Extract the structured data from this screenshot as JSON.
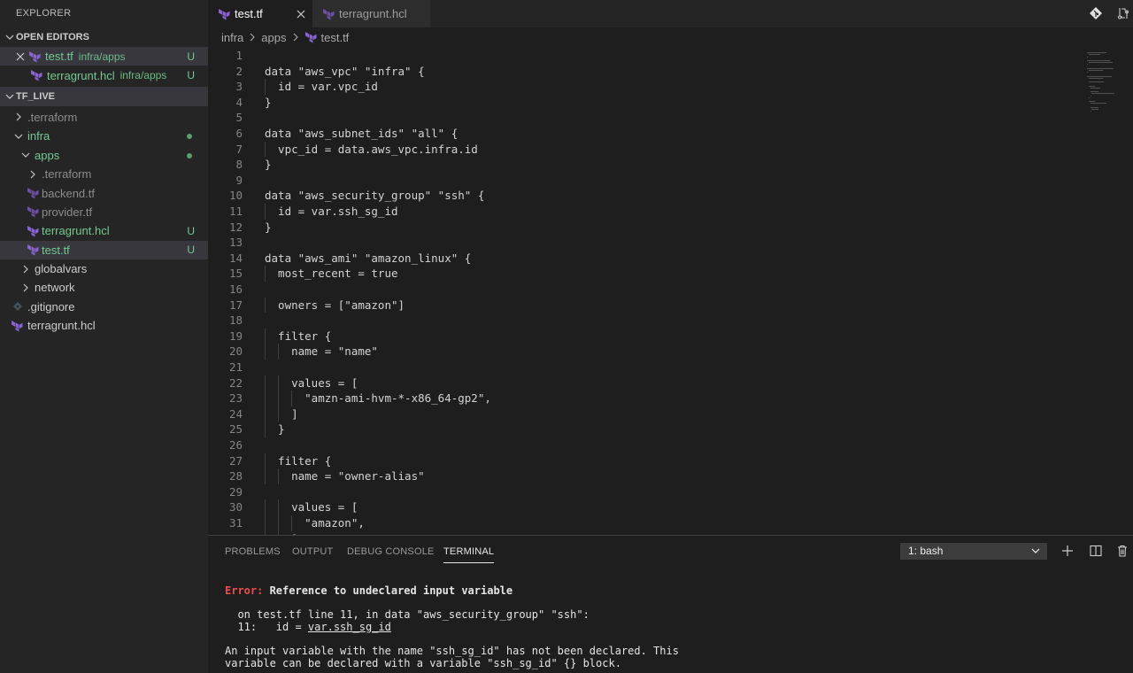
{
  "sidebar": {
    "title": "EXPLORER",
    "open_editors_header": "OPEN EDITORS",
    "open_editors": [
      {
        "name": "test.tf",
        "path": "infra/apps",
        "status": "U"
      },
      {
        "name": "terragrunt.hcl",
        "path": "infra/apps",
        "status": "U"
      }
    ],
    "project_header": "TF_LIVE",
    "tree": {
      "terraform_root": ".terraform",
      "infra": "infra",
      "apps": "apps",
      "apps_terraform": ".terraform",
      "backend": "backend.tf",
      "provider": "provider.tf",
      "terragrunt_apps": "terragrunt.hcl",
      "terragrunt_apps_status": "U",
      "test": "test.tf",
      "test_status": "U",
      "globalvars": "globalvars",
      "network": "network",
      "gitignore": ".gitignore",
      "terragrunt_root": "terragrunt.hcl"
    }
  },
  "tabs": [
    {
      "label": "test.tf",
      "active": true
    },
    {
      "label": "terragrunt.hcl",
      "active": false
    }
  ],
  "breadcrumb": [
    "infra",
    "apps",
    "test.tf"
  ],
  "editor": {
    "lines": [
      "",
      "data \"aws_vpc\" \"infra\" {",
      "  id = var.vpc_id",
      "}",
      "",
      "data \"aws_subnet_ids\" \"all\" {",
      "  vpc_id = data.aws_vpc.infra.id",
      "}",
      "",
      "data \"aws_security_group\" \"ssh\" {",
      "  id = var.ssh_sg_id",
      "}",
      "",
      "data \"aws_ami\" \"amazon_linux\" {",
      "  most_recent = true",
      "",
      "  owners = [\"amazon\"]",
      "",
      "  filter {",
      "    name = \"name\"",
      "",
      "    values = [",
      "      \"amzn-ami-hvm-*-x86_64-gp2\",",
      "    ]",
      "  }",
      "",
      "  filter {",
      "    name = \"owner-alias\"",
      "",
      "    values = [",
      "      \"amazon\",",
      "    ]"
    ]
  },
  "panel": {
    "tabs": [
      "PROBLEMS",
      "OUTPUT",
      "DEBUG CONSOLE",
      "TERMINAL"
    ],
    "active_tab": "TERMINAL",
    "terminal_select": "1: bash",
    "terminal": {
      "error_label": "Error:",
      "error_title": " Reference to undeclared input variable",
      "location": "  on test.tf line 11, in data \"aws_security_group\" \"ssh\":",
      "code_prefix": "  11:   id = ",
      "code_ref": "var.ssh_sg_id",
      "message_1": "An input variable with the name \"ssh_sg_id\" has not been declared. This",
      "message_2": "variable can be declared with a variable \"ssh_sg_id\" {} block."
    }
  },
  "colors": {
    "accent_green": "#73c991",
    "terraform_purple": "#8a63d2",
    "error_red": "#f14c4c"
  }
}
